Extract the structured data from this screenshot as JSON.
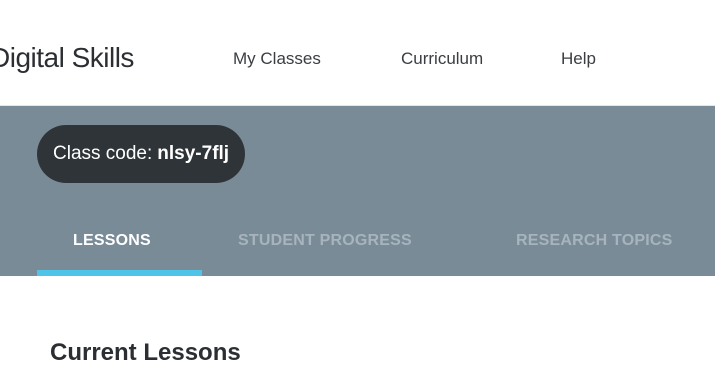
{
  "header": {
    "brand": "Digital Skills",
    "nav": {
      "my_classes": "My Classes",
      "curriculum": "Curriculum",
      "help": "Help"
    }
  },
  "class_header": {
    "code_label": "Class code:",
    "code_value": "nlsy-7flj"
  },
  "tabs": [
    {
      "label": "LESSONS",
      "active": true
    },
    {
      "label": "STUDENT PROGRESS",
      "active": false
    },
    {
      "label": "RESEARCH TOPICS",
      "active": false
    }
  ],
  "main": {
    "section_title": "Current Lessons"
  },
  "colors": {
    "band": "#7a8b98",
    "pill": "#2f3438",
    "active_tab_indicator": "#4fc3e8"
  }
}
